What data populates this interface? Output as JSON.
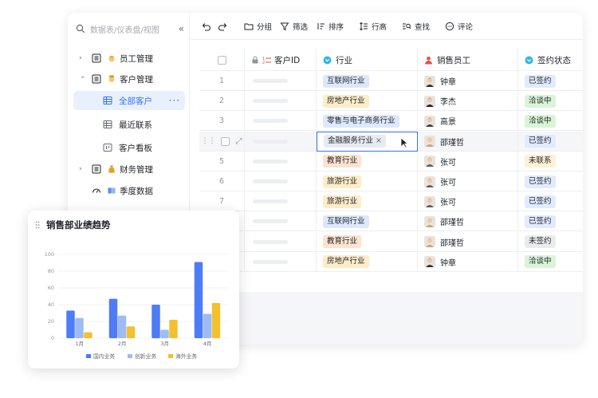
{
  "sidebar": {
    "search_placeholder": "数据表/仪表盘/视图",
    "items": [
      {
        "label": "员工管理"
      },
      {
        "label": "客户管理"
      },
      {
        "label": "全部客户"
      },
      {
        "label": "最近联系"
      },
      {
        "label": "客户看板"
      },
      {
        "label": "财务管理"
      },
      {
        "label": "季度数据"
      }
    ]
  },
  "toolbar": {
    "group": "分组",
    "filter": "筛选",
    "sort": "排序",
    "row_height": "行高",
    "find": "查找",
    "comment": "评论"
  },
  "table": {
    "headers": {
      "id": "客户ID",
      "industry": "行业",
      "sales": "销售员工",
      "status": "签约状态"
    },
    "rows": [
      {
        "num": "1",
        "industry": "互联网行业",
        "sales": "钟章",
        "status": "已签约"
      },
      {
        "num": "2",
        "industry": "房地产行业",
        "sales": "李杰",
        "status": "洽谈中"
      },
      {
        "num": "3",
        "industry": "零售与电子商务行业",
        "sales": "高景",
        "status": "洽谈中"
      },
      {
        "num": "",
        "industry": "金融服务行业",
        "sales": "邵瑾哲",
        "status": "已签约"
      },
      {
        "num": "5",
        "industry": "教育行业",
        "sales": "张可",
        "status": "未联系"
      },
      {
        "num": "6",
        "industry": "旅游行业",
        "sales": "张可",
        "status": "已签约"
      },
      {
        "num": "7",
        "industry": "旅游行业",
        "sales": "张可",
        "status": "已签约"
      },
      {
        "num": "",
        "industry": "互联网行业",
        "sales": "邵瑾哲",
        "status": "已签约"
      },
      {
        "num": "",
        "industry": "教育行业",
        "sales": "邵瑾哲",
        "status": "未签约"
      },
      {
        "num": "",
        "industry": "房地产行业",
        "sales": "钟章",
        "status": "洽谈中"
      }
    ]
  },
  "colors": {
    "accent": "#3370ff",
    "status_signed_bg": "#e1eaff",
    "status_talk_bg": "#d9f5d6",
    "status_none_bg": "#fef1d3"
  },
  "chart_card": {
    "title": "销售部业绩趋势"
  },
  "chart_data": {
    "type": "bar",
    "categories": [
      "1月",
      "2月",
      "3月",
      "4月"
    ],
    "series": [
      {
        "name": "国内业务",
        "values": [
          33,
          47,
          40,
          91
        ],
        "color": "#4e7cf6"
      },
      {
        "name": "创新业务",
        "values": [
          24,
          27,
          10,
          29
        ],
        "color": "#9dbcf5"
      },
      {
        "name": "海外业务",
        "values": [
          7,
          14,
          22,
          42
        ],
        "color": "#f2c12e"
      }
    ],
    "ylim": [
      0,
      100
    ],
    "yticks": [
      "0",
      "20",
      "40",
      "60",
      "80",
      "100"
    ],
    "grid": true,
    "legend": "bottom"
  }
}
